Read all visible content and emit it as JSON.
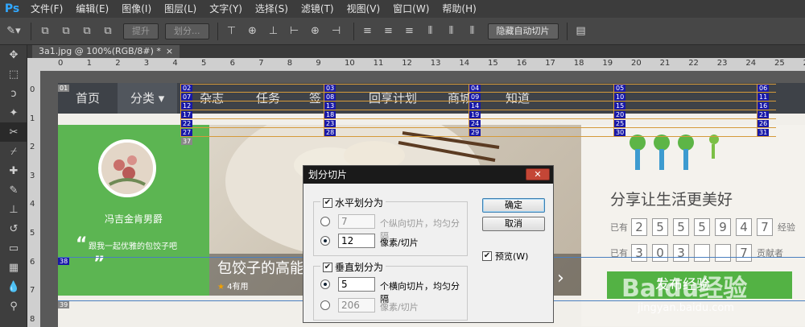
{
  "app": {
    "logo": "Ps",
    "menus": [
      "文件(F)",
      "编辑(E)",
      "图像(I)",
      "图层(L)",
      "文字(Y)",
      "选择(S)",
      "滤镜(T)",
      "视图(V)",
      "窗口(W)",
      "帮助(H)"
    ]
  },
  "options": {
    "promote_label": "提升",
    "divide_label": "划分...",
    "hide_auto_slices_label": "隐藏自动切片"
  },
  "document": {
    "tab_title": "3a1.jpg @ 100%(RGB/8#) *",
    "tab_close": "×"
  },
  "rulers": {
    "top": [
      "0",
      "1",
      "2",
      "3",
      "4",
      "5",
      "6",
      "7",
      "8",
      "9",
      "10",
      "11",
      "12",
      "13",
      "14",
      "15",
      "16",
      "17",
      "18",
      "19",
      "20",
      "21",
      "22",
      "23",
      "24",
      "25",
      "26",
      "27"
    ],
    "left": [
      "0",
      "1",
      "2",
      "3",
      "4",
      "5",
      "6",
      "7",
      "8"
    ]
  },
  "website": {
    "nav": [
      "首页",
      "分类",
      "杂志",
      "任务",
      "签",
      "回享计划",
      "商城",
      "知道"
    ],
    "user_name": "冯吉金肯男爵",
    "user_quote": "跟我一起优雅的包饺子吧",
    "headline": "包饺子的高能",
    "likes": "4有用",
    "slogan": "分享让生活更美好",
    "stat1_prefix": "已有",
    "stat1_digits": [
      "2",
      "5",
      "5",
      "5",
      "9",
      "4",
      "7"
    ],
    "stat1_suffix": "经验",
    "stat2_prefix": "已有",
    "stat2_digits": [
      "3",
      "0",
      "3",
      "",
      "",
      "7"
    ],
    "stat2_suffix": "贡献者",
    "publish_button": "发布经验",
    "watermark": "Baidu经验",
    "watermark_url": "jingyan.baidu.com"
  },
  "slices": {
    "top_row_labels": [
      "02",
      "07",
      "12",
      "17",
      "22",
      "27"
    ],
    "col2_labels": [
      "03",
      "08",
      "13",
      "18",
      "23",
      "28"
    ],
    "col3_labels": [
      "04",
      "09",
      "14",
      "19",
      "24",
      "29"
    ],
    "col4_labels": [
      "05",
      "10",
      "15",
      "20",
      "25",
      "30"
    ],
    "col5_labels": [
      "06",
      "11",
      "16",
      "21",
      "26",
      "31"
    ],
    "first": "01",
    "s37": "37",
    "s38": "38",
    "s39": "39"
  },
  "dialog": {
    "title": "划分切片",
    "close": "✕",
    "horizontal_label": "水平划分为",
    "h_count_value": "7",
    "h_count_label": "个纵向切片，均匀分隔",
    "h_pixels_value": "12",
    "h_pixels_label": "像素/切片",
    "vertical_label": "垂直划分为",
    "v_count_value": "5",
    "v_count_label": "个横向切片，均匀分隔",
    "v_pixels_value": "206",
    "v_pixels_label": "像素/切片",
    "ok": "确定",
    "cancel": "取消",
    "preview": "预览(W)"
  }
}
